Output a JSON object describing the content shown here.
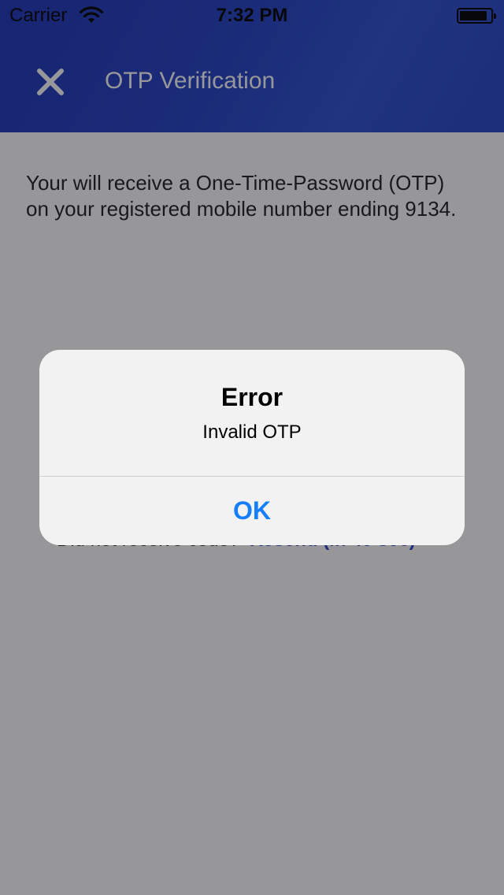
{
  "status_bar": {
    "carrier": "Carrier",
    "time": "7:32 PM",
    "icons": [
      "wifi-icon",
      "battery-icon"
    ]
  },
  "nav": {
    "title": "OTP Verification",
    "close_icon": "close-icon"
  },
  "content": {
    "instructions": "Your will receive a One-Time-Password (OTP) on your registered mobile number ending 9134.",
    "resend_prompt": "Did not receive code?",
    "resend_link": "Resend (in 40 sec)"
  },
  "alert": {
    "title": "Error",
    "message": "Invalid OTP",
    "ok_label": "OK"
  },
  "colors": {
    "header": "#2543c5",
    "alert_action": "#157efb",
    "overlay": "rgba(18,18,24,0.44)"
  }
}
